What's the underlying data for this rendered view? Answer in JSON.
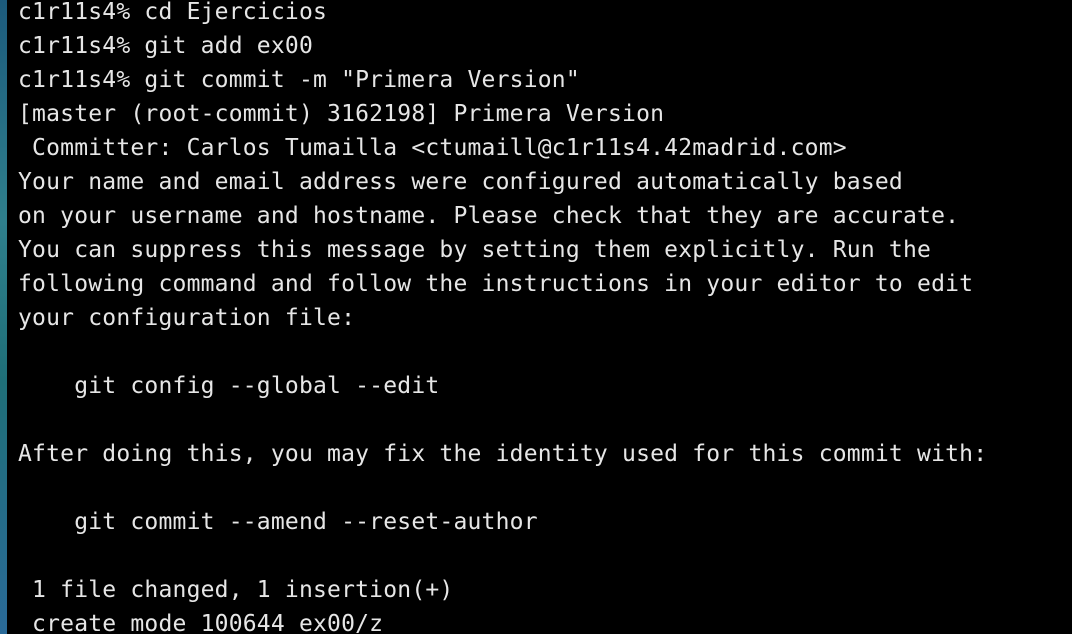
{
  "terminal": {
    "lines": [
      "c1r11s4% cd Ejercicios",
      "c1r11s4% git add ex00",
      "c1r11s4% git commit -m \"Primera Version\"",
      "[master (root-commit) 3162198] Primera Version",
      " Committer: Carlos Tumailla <ctumaill@c1r11s4.42madrid.com>",
      "Your name and email address were configured automatically based",
      "on your username and hostname. Please check that they are accurate.",
      "You can suppress this message by setting them explicitly. Run the",
      "following command and follow the instructions in your editor to edit",
      "your configuration file:",
      "",
      "    git config --global --edit",
      "",
      "After doing this, you may fix the identity used for this commit with:",
      "",
      "    git commit --amend --reset-author",
      "",
      " 1 file changed, 1 insertion(+)",
      " create mode 100644 ex00/z"
    ]
  },
  "colors": {
    "background": "#000000",
    "text": "#e6e6e6"
  }
}
